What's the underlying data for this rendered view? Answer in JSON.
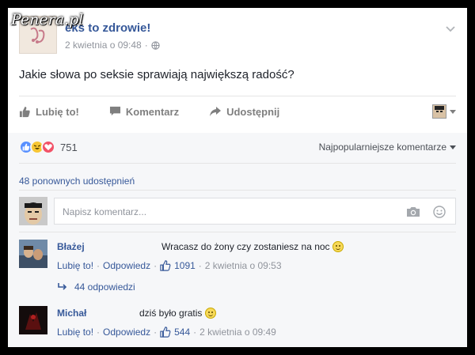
{
  "watermark": "Penera.pl",
  "post": {
    "page_name": "Seks to zdrowie!",
    "page_name_visible": "eks to zdrowie!",
    "timestamp": "2 kwietnia o 09:48",
    "text": "Jakie słowa po seksie sprawiają największą radość?"
  },
  "actions": {
    "like": "Lubię to!",
    "comment": "Komentarz",
    "share": "Udostępnij"
  },
  "reactions": {
    "count": "751",
    "types": [
      "like",
      "haha",
      "love"
    ],
    "sort_label": "Najpopularniejsze komentarze"
  },
  "shares": {
    "label": "48 ponownych udostępnień"
  },
  "composer": {
    "placeholder": "Napisz komentarz..."
  },
  "comments": [
    {
      "author": "Błażej",
      "text": "Wracasz do żony czy zostaniesz na noc",
      "like": "Lubię to!",
      "reply": "Odpowiedz",
      "likes": "1091",
      "time": "2 kwietnia o 09:53",
      "replies_label": "44 odpowiedzi"
    },
    {
      "author": "Michał",
      "text": "dziś było gratis",
      "like": "Lubię to!",
      "reply": "Odpowiedz",
      "likes": "544",
      "time": "2 kwietnia o 09:49"
    }
  ],
  "colors": {
    "link": "#365899",
    "muted": "#90949c",
    "like_blue": "#5890ff",
    "haha_yellow": "#f7c634",
    "love_red": "#f25268"
  }
}
